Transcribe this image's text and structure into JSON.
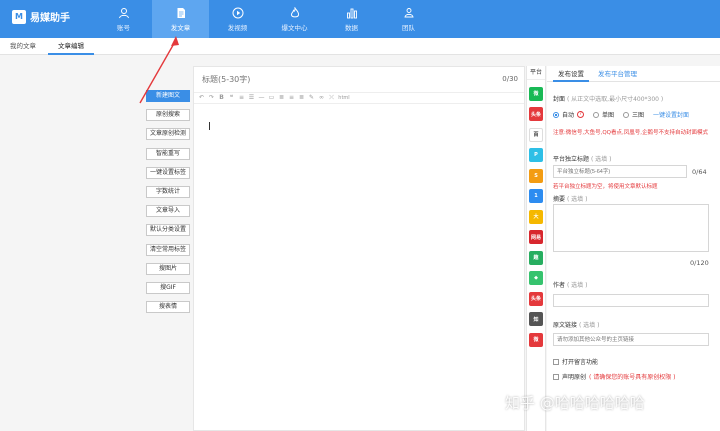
{
  "app": {
    "logo_text": "M",
    "name": "易媒助手"
  },
  "nav": [
    {
      "id": "account",
      "label": "账号",
      "icon": "user-icon"
    },
    {
      "id": "post",
      "label": "发文章",
      "icon": "document-icon",
      "active": true
    },
    {
      "id": "video",
      "label": "发视频",
      "icon": "play-icon"
    },
    {
      "id": "hot",
      "label": "爆文中心",
      "icon": "flame-icon"
    },
    {
      "id": "data",
      "label": "数据",
      "icon": "bar-chart-icon"
    },
    {
      "id": "team",
      "label": "团队",
      "icon": "team-icon"
    }
  ],
  "subtabs": [
    {
      "label": "我的文章"
    },
    {
      "label": "文章编辑",
      "active": true
    }
  ],
  "tools": [
    {
      "label": "新建图文",
      "primary": true
    },
    {
      "label": "原创搜索"
    },
    {
      "label": "文章原创检测"
    },
    {
      "label": "智能重写"
    },
    {
      "label": "一键设置标签"
    },
    {
      "label": "字数统计"
    },
    {
      "label": "文章导入"
    },
    {
      "label": "默认分类设置"
    },
    {
      "label": "清空常用标签"
    },
    {
      "label": "搜图片"
    },
    {
      "label": "搜GIF"
    },
    {
      "label": "搜表情"
    }
  ],
  "editor": {
    "title_placeholder": "标题(5-30字)",
    "title_count": "0/30",
    "toolbar_icons": [
      "undo-icon",
      "redo-icon",
      "bold-icon",
      "quote-icon",
      "list-ordered-icon",
      "list-unordered-icon",
      "hr-icon",
      "image-icon",
      "align-left-icon",
      "align-center-icon",
      "align-right-icon",
      "brush-icon",
      "link-icon",
      "unlink-icon",
      "html-icon"
    ],
    "toolbar_html_label": "html"
  },
  "platforms": {
    "header": "平台",
    "items": [
      {
        "name": "wechat-icon",
        "text": "微",
        "color": "#19b955"
      },
      {
        "name": "toutiao-icon",
        "text": "头条",
        "color": "#e4393c"
      },
      {
        "name": "baijia-icon",
        "text": "百",
        "color": "#ffffff",
        "fg": "#333"
      },
      {
        "name": "penguin-icon",
        "text": "P",
        "color": "#2ebfe6"
      },
      {
        "name": "sohu-icon",
        "text": "S",
        "color": "#f39c12"
      },
      {
        "name": "yidian-icon",
        "text": "1",
        "color": "#2d8cf0"
      },
      {
        "name": "dayu-icon",
        "text": "大",
        "color": "#f5b800"
      },
      {
        "name": "netease-icon",
        "text": "网易",
        "color": "#d8272e"
      },
      {
        "name": "qutoutiao-icon",
        "text": "趣",
        "color": "#27ae60"
      },
      {
        "name": "yidianzixun-icon",
        "text": "◆",
        "color": "#36c36e"
      },
      {
        "name": "douyin-icon",
        "text": "头条",
        "color": "#e4393c"
      },
      {
        "name": "zhihu-icon",
        "text": "知",
        "color": "#555555"
      },
      {
        "name": "weibo-icon",
        "text": "微",
        "color": "#e4393c"
      }
    ]
  },
  "panel": {
    "tabs": [
      {
        "label": "发布设置",
        "active": true
      },
      {
        "label": "发布平台管理"
      }
    ],
    "cover_label": "封面",
    "cover_hint": "( 从正文中选取,最小尺寸400*300 )",
    "cover_options": [
      {
        "label": "自动",
        "selected": true
      },
      {
        "label": "单图"
      },
      {
        "label": "三图"
      }
    ],
    "cover_link": "一键设置封面",
    "cover_warning": "注意:微信号,大鱼号,QQ看点,凤凰号,企鹅号不支持自动封面模式",
    "indep_title_label": "平台独立标题",
    "indep_title_hint": "( 选填 )",
    "indep_title_placeholder": "平台独立标题(5-64字)",
    "indep_title_count": "0/64",
    "indep_title_warning": "若平台独立标题为空，将使用文章默认标题",
    "summary_label": "摘要",
    "summary_hint": "( 选填 )",
    "summary_count": "0/120",
    "author_label": "作者",
    "author_hint": "( 选填 )",
    "origin_label": "原文链接",
    "origin_hint": "( 选填 )",
    "origin_placeholder": "请勿添加其他公众号的主页链接",
    "comment_label": "打开留言功能",
    "declare_label": "声明原创",
    "declare_hint": "( 请确保您的账号具有原创权限 )"
  },
  "watermark": "知乎 @哈哈哈哈哈哈",
  "colors": {
    "brand": "#3a8ee6",
    "warning": "#e4393c"
  }
}
